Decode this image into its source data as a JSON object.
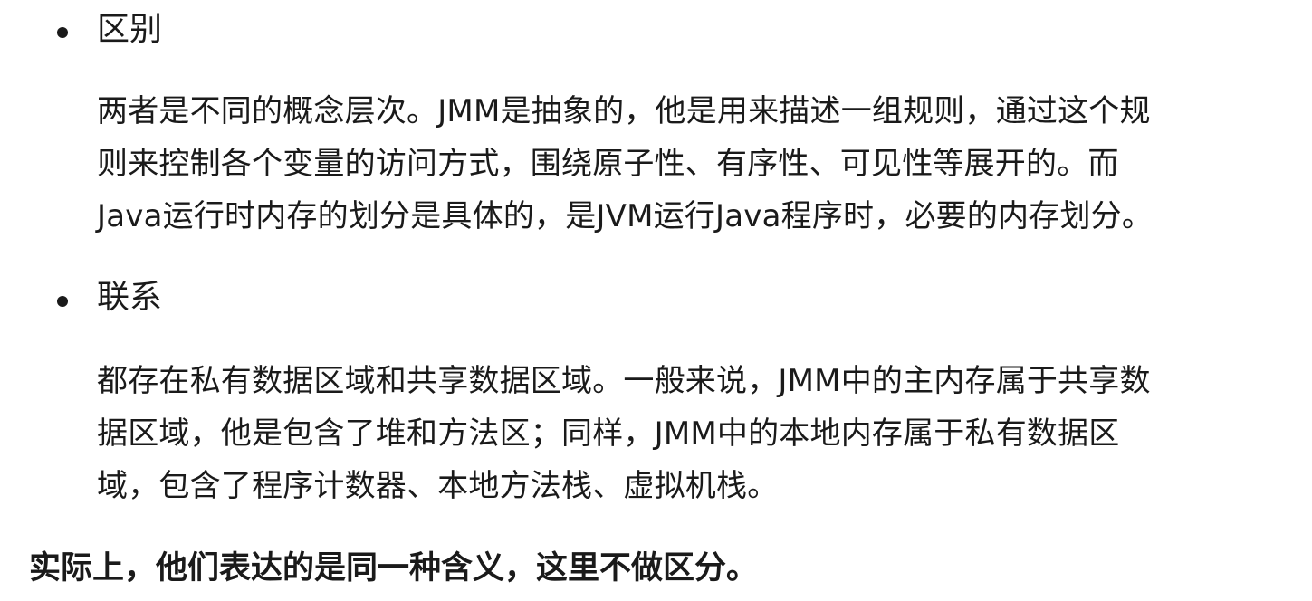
{
  "sections": [
    {
      "heading": "区别",
      "lines": [
        "两者是不同的概念层次。JMM是抽象的，他是用来描述一组规则，通过这个规",
        "则来控制各个变量的访问方式，围绕原子性、有序性、可见性等展开的。而",
        "Java运行时内存的划分是具体的，是JVM运行Java程序时，必要的内存划分。"
      ]
    },
    {
      "heading": "联系",
      "lines": [
        "都存在私有数据区域和共享数据区域。一般来说，JMM中的主内存属于共享数",
        "据区域，他是包含了堆和方法区；同样，JMM中的本地内存属于私有数据区",
        "域，包含了程序计数器、本地方法栈、虚拟机栈。"
      ]
    }
  ],
  "conclusion": "实际上，他们表达的是同一种含义，这里不做区分。"
}
